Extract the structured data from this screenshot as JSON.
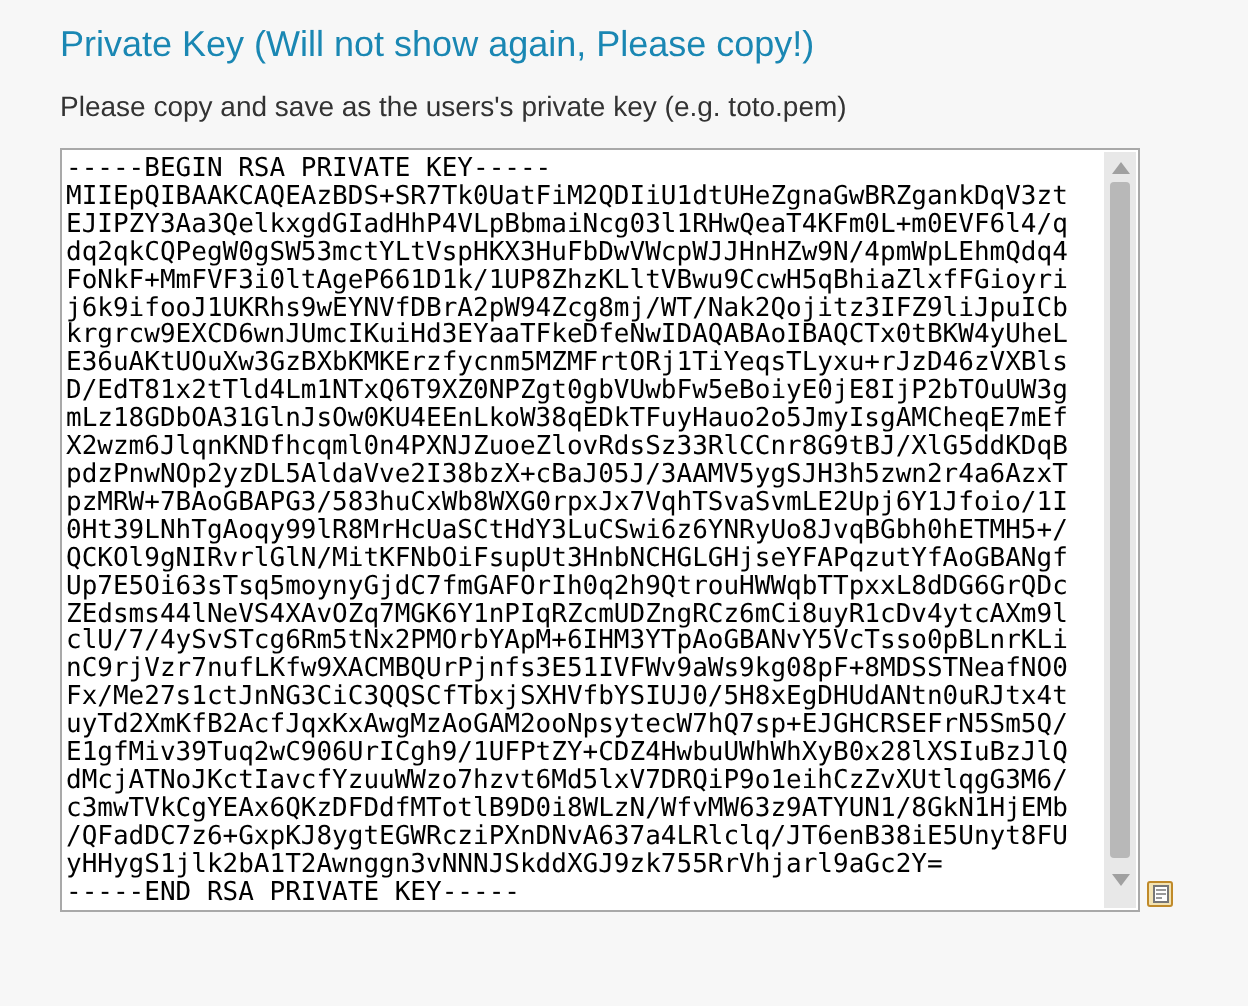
{
  "title": "Private Key (Will not show again, Please copy!)",
  "instruction": "Please copy and save as the users's private key (e.g. toto.pem)",
  "private_key": {
    "lines": [
      "-----BEGIN RSA PRIVATE KEY-----",
      "MIIEpQIBAAKCAQEAzBDS+SR7Tk0UatFiM2QDIiU1dtUHeZgnaGwBRZgankDqV3zt",
      "EJIPZY3Aa3QelkxgdGIadHhP4VLpBbmaiNcg03l1RHwQeaT4KFm0L+m0EVF6l4/q",
      "dq2qkCQPegW0gSW53mctYLtVspHKX3HuFbDwVWcpWJJHnHZw9N/4pmWpLEhmQdq4",
      "FoNkF+MmFVF3i0ltAgeP661D1k/1UP8ZhzKLltVBwu9CcwH5qBhiaZlxfFGioyri",
      "j6k9ifooJ1UKRhs9wEYNVfDBrA2pW94Zcg8mj/WT/Nak2Qojitz3IFZ9liJpuICb",
      "krgrcw9EXCD6wnJUmcIKuiHd3EYaaTFkeDfeNwIDAQABAoIBAQCTx0tBKW4yUheL",
      "E36uAKtUOuXw3GzBXbKMKErzfycnm5MZMFrtORj1TiYeqsTLyxu+rJzD46zVXBls",
      "D/EdT81x2tTld4Lm1NTxQ6T9XZ0NPZgt0gbVUwbFw5eBoiyE0jE8IjP2bTOuUW3g",
      "mLz18GDbOA31GlnJsOw0KU4EEnLkoW38qEDkTFuyHauo2o5JmyIsgAMCheqE7mEf",
      "X2wzm6JlqnKNDfhcqml0n4PXNJZuoeZlovRdsSz33RlCCnr8G9tBJ/XlG5ddKDqB",
      "pdzPnwNOp2yzDL5AldaVve2I38bzX+cBaJ05J/3AAMV5ygSJH3h5zwn2r4a6AzxT",
      "pzMRW+7BAoGBAPG3/583huCxWb8WXG0rpxJx7VqhTSvaSvmLE2Upj6Y1Jfoio/1I",
      "0Ht39LNhTgAoqy99lR8MrHcUaSCtHdY3LuCSwi6z6YNRyUo8JvqBGbh0hETMH5+/",
      "QCKOl9gNIRvrlGlN/MitKFNbOiFsupUt3HnbNCHGLGHjseYFAPqzutYfAoGBANgf",
      "Up7E5Oi63sTsq5moynyGjdC7fmGAFOrIh0q2h9QtrouHWWqbTTpxxL8dDG6GrQDc",
      "ZEdsms44lNeVS4XAvOZq7MGK6Y1nPIqRZcmUDZngRCz6mCi8uyR1cDv4ytcAXm9l",
      "clU/7/4ySvSTcg6Rm5tNx2PMOrbYApM+6IHM3YTpAoGBANvY5VcTsso0pBLnrKLi",
      "nC9rjVzr7nufLKfw9XACMBQUrPjnfs3E51IVFWv9aWs9kg08pF+8MDSSTNeafNO0",
      "Fx/Me27s1ctJnNG3CiC3QQSCfTbxjSXHVfbYSIUJ0/5H8xEgDHUdANtn0uRJtx4t",
      "uyTd2XmKfB2AcfJqxKxAwgMzAoGAM2ooNpsytecW7hQ7sp+EJGHCRSEFrN5Sm5Q/",
      "E1gfMiv39Tuq2wC906UrICgh9/1UFPtZY+CDZ4HwbuUWhWhXyB0x28lXSIuBzJlQ",
      "dMcjATNoJKctIavcfYzuuWWzo7hzvt6Md5lxV7DRQiP9o1eihCzZvXUtlqgG3M6/",
      "c3mwTVkCgYEAx6QKzDFDdfMTotlB9D0i8WLzN/WfvMW63z9ATYUN1/8GkN1HjEMb",
      "/QFadDC7z6+GxpKJ8ygtEGWRcziPXnDNvA637a4LRlclq/JT6enB38iE5Unyt8FU",
      "yHHygS1jlk2bA1T2Awnggn3vNNNJSkddXGJ9zk755RrVhjarl9aGc2Y=",
      "-----END RSA PRIVATE KEY-----"
    ]
  }
}
